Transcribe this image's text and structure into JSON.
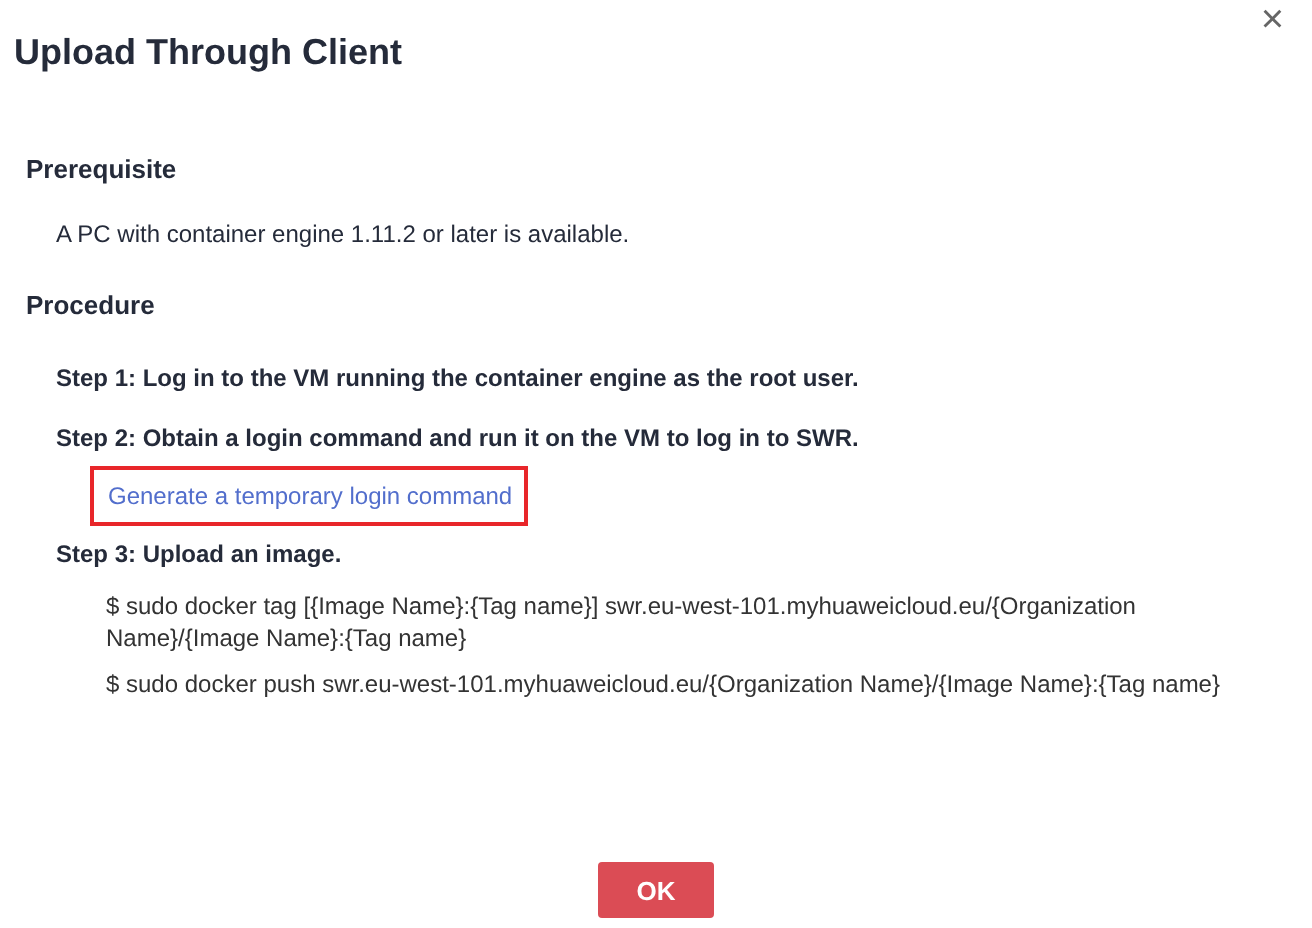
{
  "dialog": {
    "title": "Upload Through Client",
    "close_icon": "×"
  },
  "prerequisite": {
    "heading": "Prerequisite",
    "text": "A PC with container engine 1.11.2 or later is available."
  },
  "procedure": {
    "heading": "Procedure",
    "steps": [
      {
        "text": "Step 1: Log in to the VM running the container engine as the root user."
      },
      {
        "text": "Step 2: Obtain a login command and run it on the VM to log in to SWR.",
        "link": {
          "label": "Generate a temporary login command",
          "highlighted": true
        }
      },
      {
        "text": "Step 3: Upload an image.",
        "commands": [
          "$ sudo docker tag [{Image Name}:{Tag name}] swr.eu-west-101.myhuaweicloud.eu/{Organization Name}/{Image Name}:{Tag name}",
          "$ sudo docker push swr.eu-west-101.myhuaweicloud.eu/{Organization Name}/{Image Name}:{Tag name}"
        ]
      }
    ]
  },
  "buttons": [
    "OK"
  ]
}
